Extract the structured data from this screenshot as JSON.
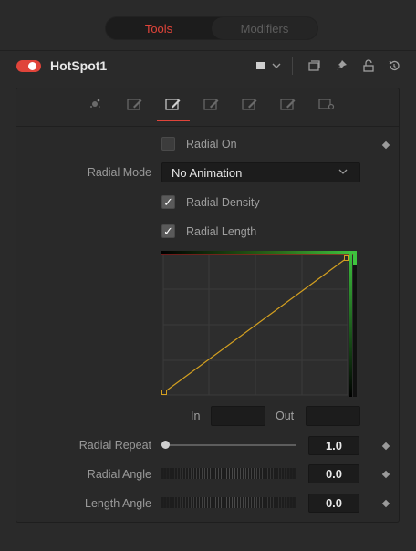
{
  "top_tabs": {
    "tools": "Tools",
    "modifiers": "Modifiers"
  },
  "tool": {
    "name": "HotSpot1",
    "enabled": true
  },
  "header_icons": [
    "color-swatch-icon",
    "chevron-down-icon",
    "view-icon",
    "pin-icon",
    "lock-icon",
    "reset-icon"
  ],
  "subtabs": [
    "hotspot-icon",
    "edit-icon",
    "edit-icon",
    "edit-icon",
    "edit-icon",
    "edit-icon",
    "settings-icon"
  ],
  "active_subtab": 2,
  "controls": {
    "radial_on": {
      "label": "Radial On",
      "checked": false
    },
    "radial_mode": {
      "label": "Radial Mode",
      "value": "No Animation"
    },
    "radial_density": {
      "label": "Radial Density",
      "checked": true
    },
    "radial_length": {
      "label": "Radial Length",
      "checked": true
    },
    "curve": {
      "in_label": "In",
      "out_label": "Out",
      "in_value": "",
      "out_value": ""
    },
    "radial_repeat": {
      "label": "Radial Repeat",
      "value": "1.0",
      "slider_fraction": 0.0
    },
    "radial_angle": {
      "label": "Radial Angle",
      "value": "0.0"
    },
    "length_angle": {
      "label": "Length Angle",
      "value": "0.0"
    }
  },
  "colors": {
    "accent": "#e0443a",
    "curve": "#d4a020",
    "green": "#3ec43e",
    "red": "#c02a2a"
  },
  "checkmark": "✓"
}
